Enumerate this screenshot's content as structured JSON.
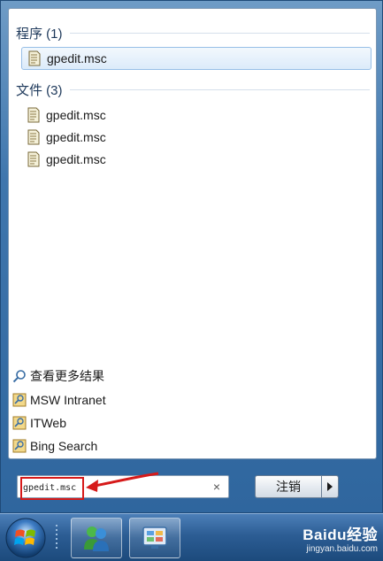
{
  "groups": {
    "programs": {
      "header": "程序 (1)"
    },
    "files": {
      "header": "文件 (3)"
    }
  },
  "results": {
    "programs": [
      {
        "label": "gpedit.msc",
        "icon": "document-icon"
      }
    ],
    "files": [
      {
        "label": "gpedit.msc",
        "icon": "document-icon"
      },
      {
        "label": "gpedit.msc",
        "icon": "document-icon"
      },
      {
        "label": "gpedit.msc",
        "icon": "document-icon"
      }
    ]
  },
  "links": {
    "see_more": "查看更多结果",
    "items": [
      {
        "label": "MSW Intranet",
        "icon": "search-connector-icon"
      },
      {
        "label": "ITWeb",
        "icon": "search-connector-icon"
      },
      {
        "label": "Bing Search",
        "icon": "search-connector-icon"
      }
    ]
  },
  "search": {
    "value": "gpedit.msc",
    "clear_symbol": "×"
  },
  "shutdown": {
    "label": "注销"
  },
  "watermark": {
    "logo": "Baidu经验",
    "url": "jingyan.baidu.com"
  },
  "colors": {
    "highlight": "#d61a1a",
    "accent": "#2c5d94"
  }
}
